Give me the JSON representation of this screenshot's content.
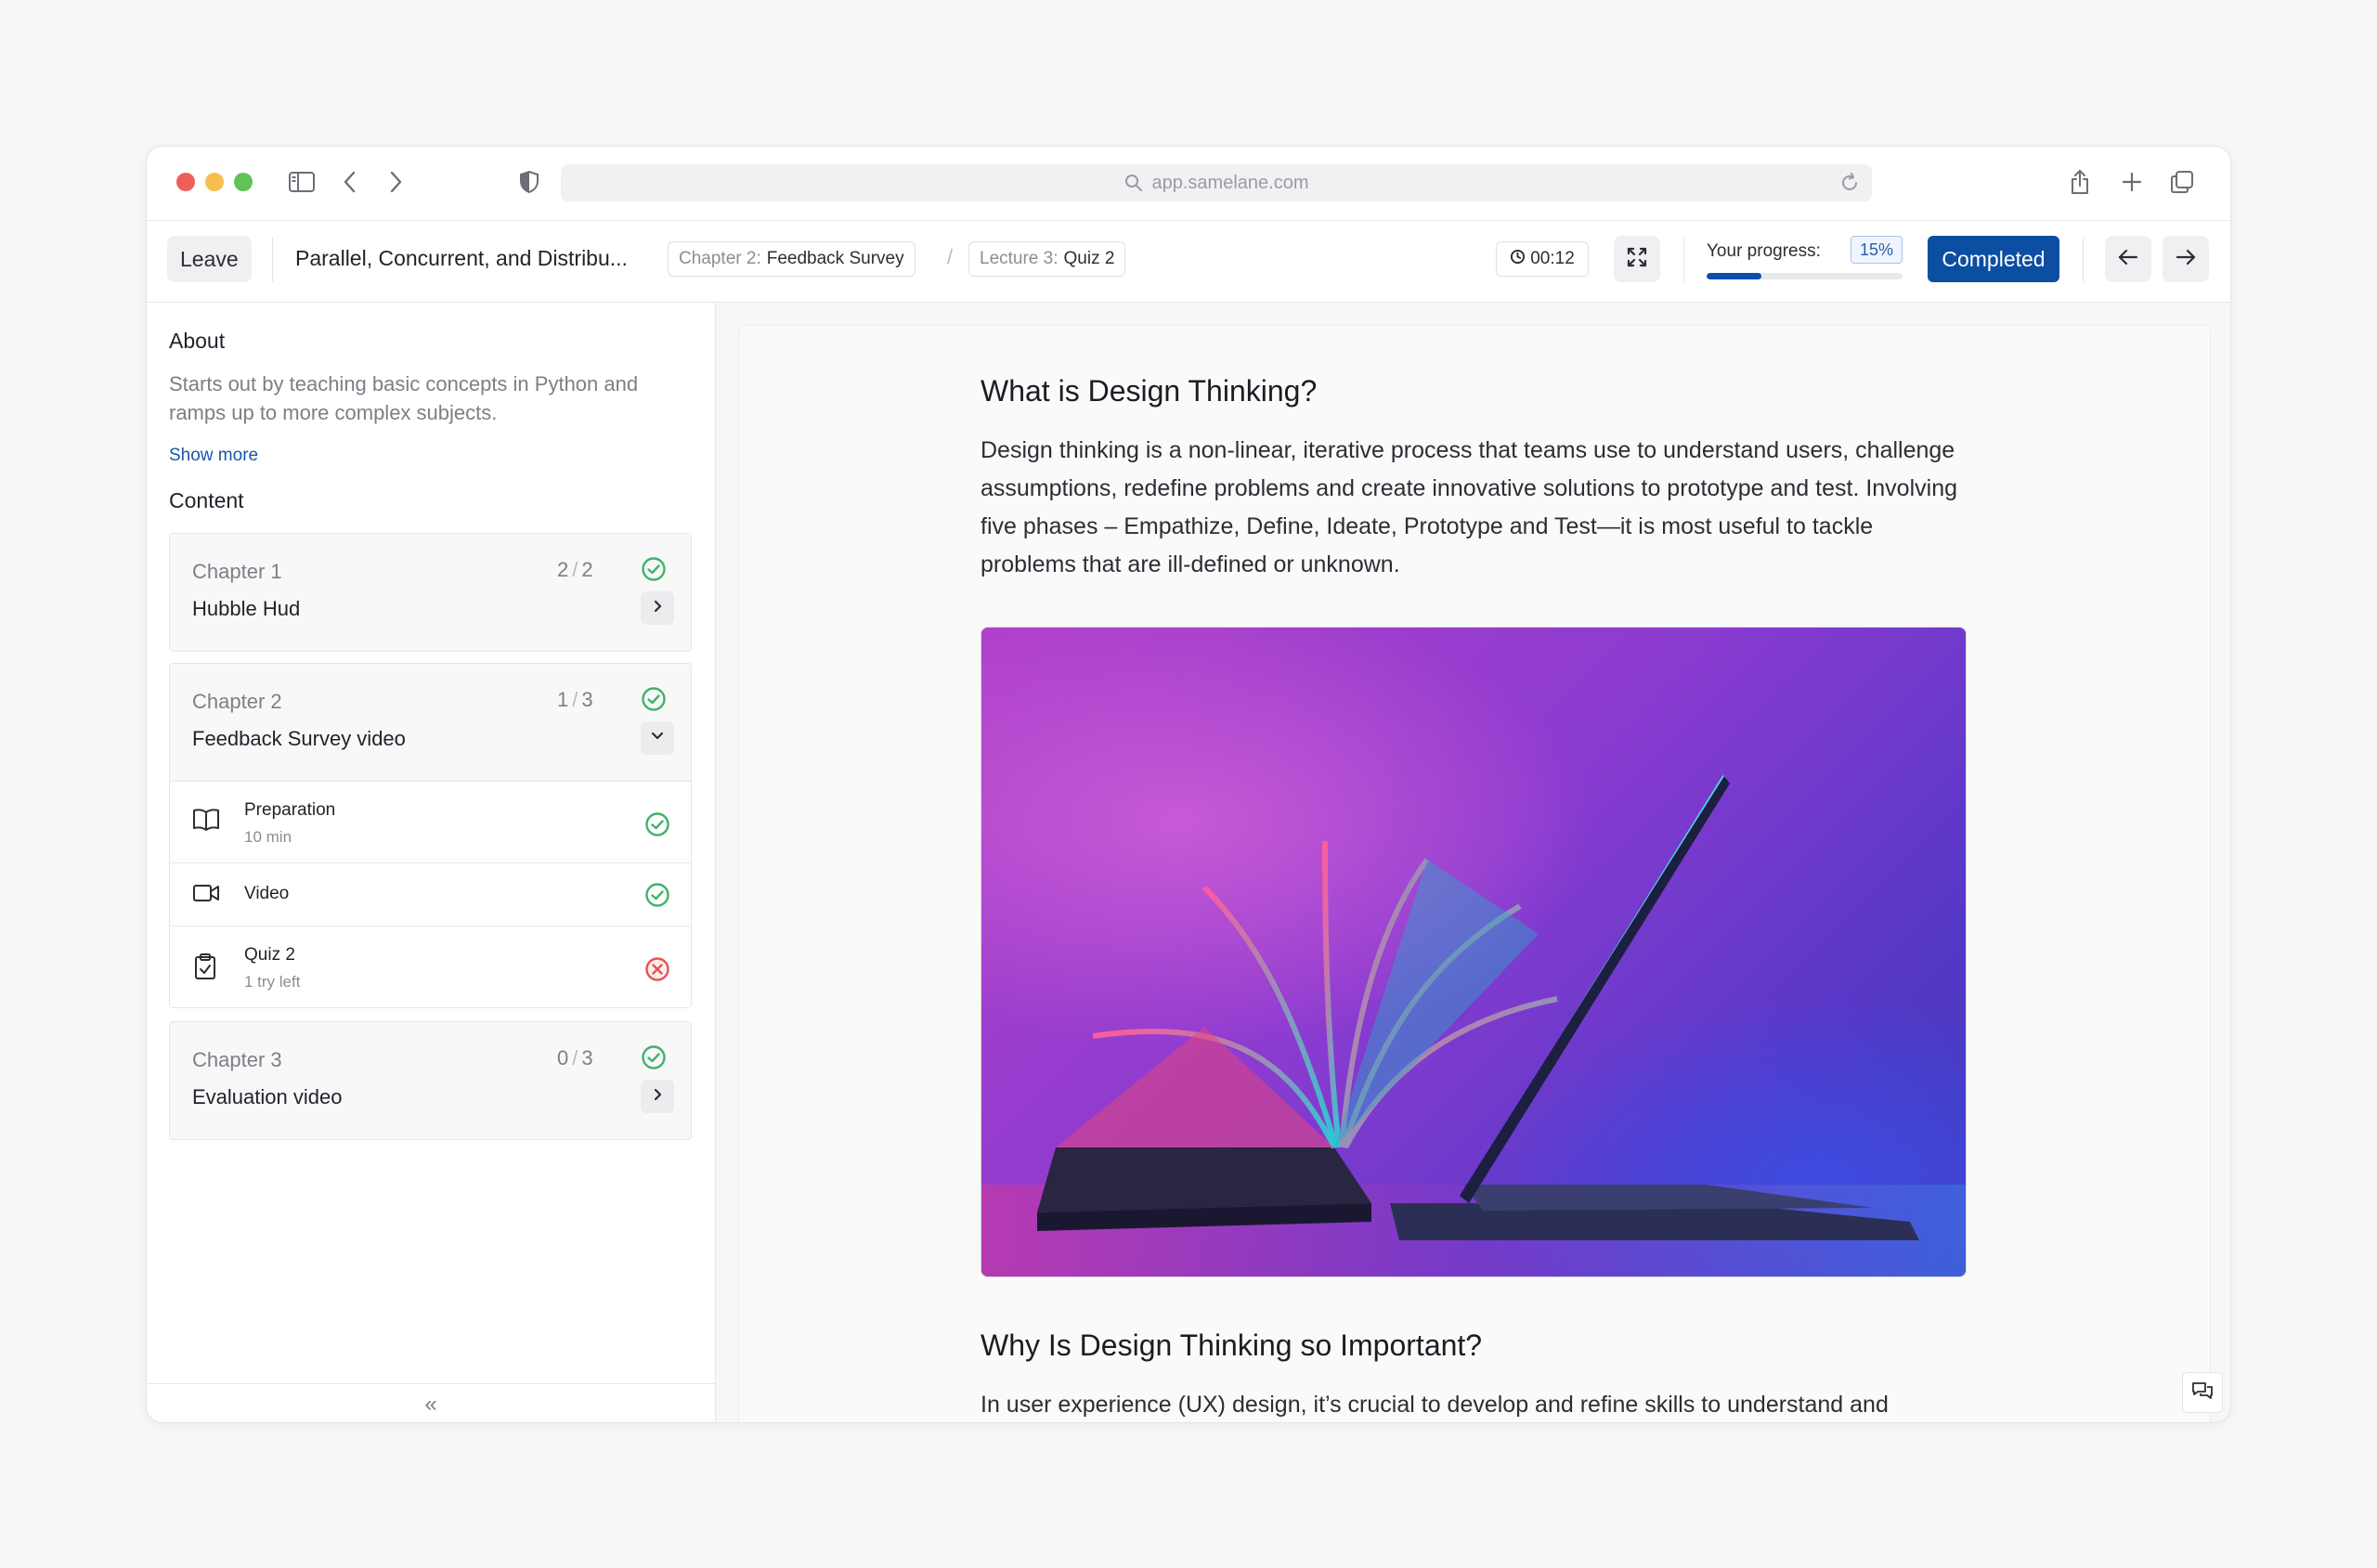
{
  "browser": {
    "url": "app.samelane.com"
  },
  "toolbar": {
    "leave_label": "Leave",
    "course_title": "Parallel, Concurrent, and Distribu...",
    "breadcrumb": [
      {
        "key": "Chapter 2:",
        "value": "Feedback Survey"
      },
      {
        "key": "Lecture 3:",
        "value": "Quiz 2"
      }
    ],
    "breadcrumb_separator": "/",
    "timer": "00:12",
    "progress_label": "Your progress:",
    "progress_value": "15%",
    "progress_fraction": 0.28,
    "completed_label": "Completed"
  },
  "sidebar": {
    "about_heading": "About",
    "about_text": "Starts out by teaching basic concepts in Python and ramps up to more complex subjects.",
    "show_more": "Show more",
    "content_heading": "Content",
    "chapters": [
      {
        "label": "Chapter 1",
        "done": "2",
        "total": "2",
        "name": "Hubble Hud",
        "expanded": false,
        "status": "complete"
      },
      {
        "label": "Chapter 2",
        "done": "1",
        "total": "3",
        "name": "Feedback Survey video",
        "expanded": true,
        "status": "complete",
        "lectures": [
          {
            "title": "Preparation",
            "subtitle": "10 min",
            "icon": "book-icon",
            "status": "complete"
          },
          {
            "title": "Video",
            "subtitle": "",
            "icon": "video-camera-icon",
            "status": "complete"
          },
          {
            "title": "Quiz 2",
            "subtitle": "1 try left",
            "icon": "clipboard-check-icon",
            "status": "failed"
          }
        ]
      },
      {
        "label": "Chapter 3",
        "done": "0",
        "total": "3",
        "name": "Evaluation video",
        "expanded": false,
        "status": "complete"
      }
    ],
    "collapse_label": "«"
  },
  "article": {
    "heading1": "What is Design Thinking?",
    "paragraph1": "Design thinking is a non-linear, iterative process that teams use to understand users, challenge assumptions, redefine problems and create innovative solutions to prototype and test. Involving five phases – Empathize, Define, Ideate, Prototype and Test—it is most useful to tackle problems that are ill-defined or unknown.",
    "heading2": "Why Is Design Thinking so Important?",
    "paragraph2": "In user experience (UX) design, it’s crucial to develop and refine skills to understand and"
  },
  "colors": {
    "accent": "#0b4ea2",
    "success": "#3fb36b",
    "danger": "#e25555",
    "link": "#1a56a8"
  }
}
